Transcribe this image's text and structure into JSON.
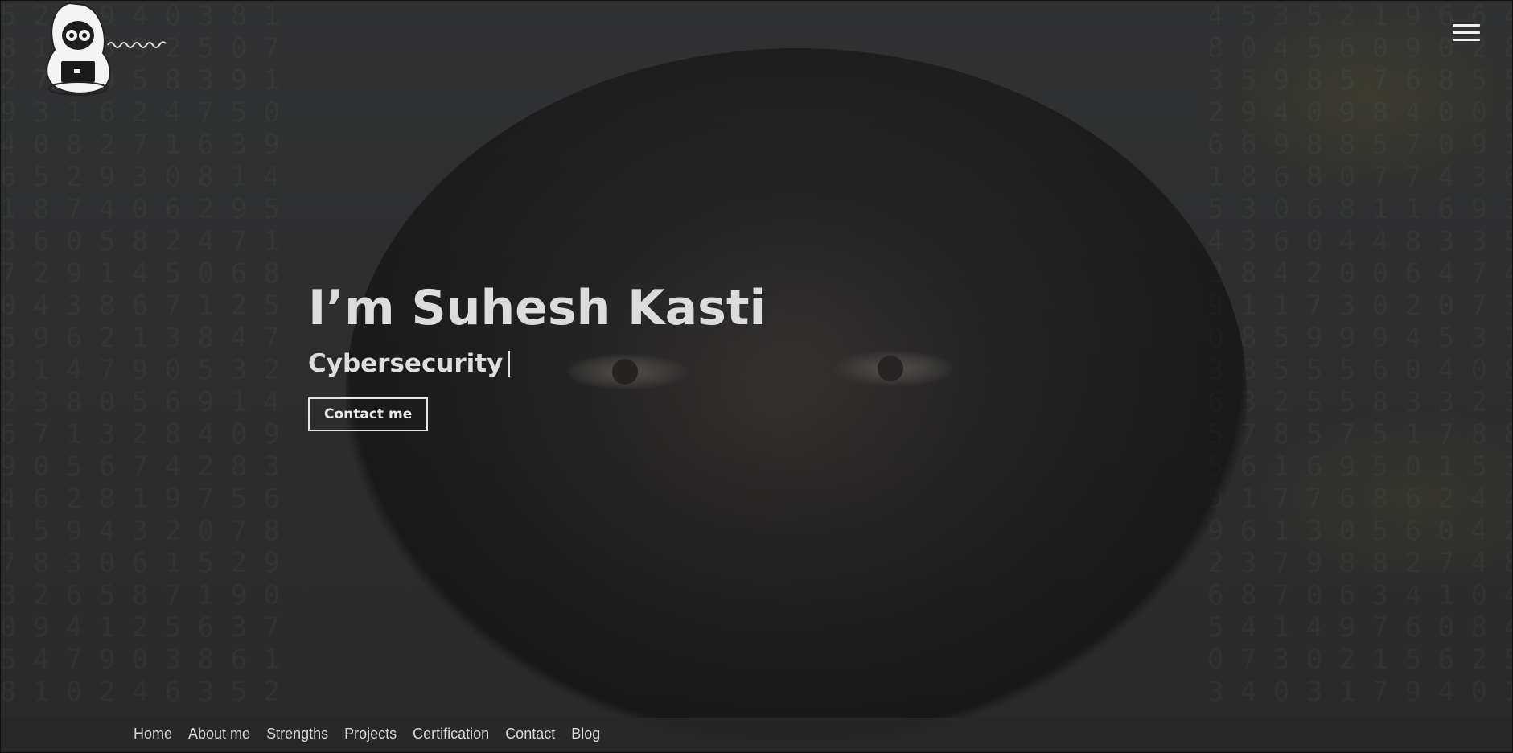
{
  "header": {
    "logo_icon": "hacker-with-laptop-logo",
    "menu_icon": "hamburger-menu-icon"
  },
  "hero": {
    "title": "I’m Suhesh Kasti",
    "typed_text": "Cybersecurity",
    "contact_button_label": "Contact me"
  },
  "nav": {
    "items": [
      {
        "label": "Home"
      },
      {
        "label": "About me"
      },
      {
        "label": "Strengths"
      },
      {
        "label": "Projects"
      },
      {
        "label": "Certification"
      },
      {
        "label": "Contact"
      },
      {
        "label": "Blog"
      }
    ]
  },
  "colors": {
    "background": "#2d2d2e",
    "text": "#dcdcdc",
    "button_border": "#e6e6e6"
  }
}
